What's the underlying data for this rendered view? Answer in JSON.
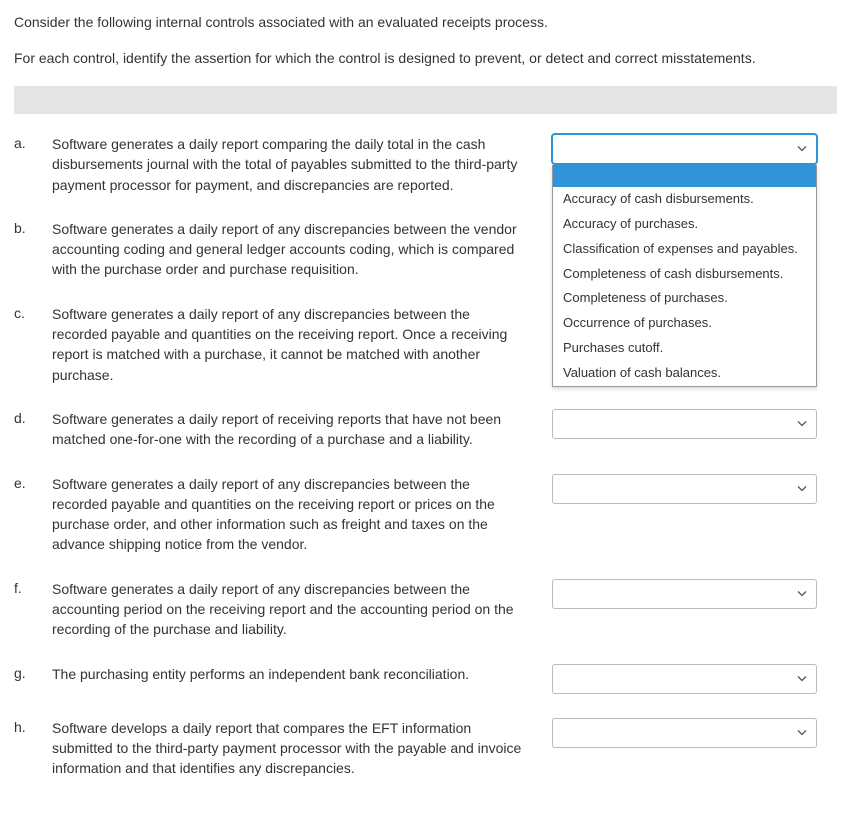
{
  "instructions": {
    "line1": "Consider the following internal controls associated with an evaluated receipts process.",
    "line2": "For each control, identify the assertion for which the control is designed to prevent, or detect and correct misstatements."
  },
  "questions": [
    {
      "letter": "a.",
      "text": "Software generates a daily report comparing the daily total in the cash disbursements journal with the total of payables submitted to the third-party payment processor for payment, and discrepancies are reported.",
      "dropdownOpen": true
    },
    {
      "letter": "b.",
      "text": "Software generates a daily report of any discrepancies between the vendor accounting coding and general ledger accounts coding, which is compared with the purchase order and purchase requisition.",
      "dropdownOpen": false,
      "hideDropdown": true
    },
    {
      "letter": "c.",
      "text": "Software generates a daily report of any discrepancies between the recorded payable and quantities on the receiving report. Once a receiving report is matched with a purchase, it cannot be matched with another purchase.",
      "dropdownOpen": false,
      "hideDropdown": true
    },
    {
      "letter": "d.",
      "text": "Software generates a daily report of receiving reports that have not been matched one-for-one with the recording of a purchase and a liability.",
      "dropdownOpen": false
    },
    {
      "letter": "e.",
      "text": "Software generates a daily report of any discrepancies between the recorded payable and quantities on the receiving report or prices on the purchase order, and other information such as freight and taxes on the advance shipping notice from the vendor.",
      "dropdownOpen": false
    },
    {
      "letter": "f.",
      "text": "Software generates a daily report of any discrepancies between the accounting period on the receiving report and the accounting period on the recording of the purchase and liability.",
      "dropdownOpen": false
    },
    {
      "letter": "g.",
      "text": "The purchasing entity performs an independent bank reconciliation.",
      "dropdownOpen": false
    },
    {
      "letter": "h.",
      "text": "Software develops a daily report that compares the EFT information submitted to the third-party payment processor with the payable and invoice information and that identifies any discrepancies.",
      "dropdownOpen": false
    }
  ],
  "dropdownOptions": [
    "Accuracy of cash disbursements.",
    "Accuracy of purchases.",
    "Classification of expenses and payables.",
    "Completeness of cash disbursements.",
    "Completeness of purchases.",
    "Occurrence of purchases.",
    "Purchases cutoff.",
    "Valuation of cash balances."
  ]
}
